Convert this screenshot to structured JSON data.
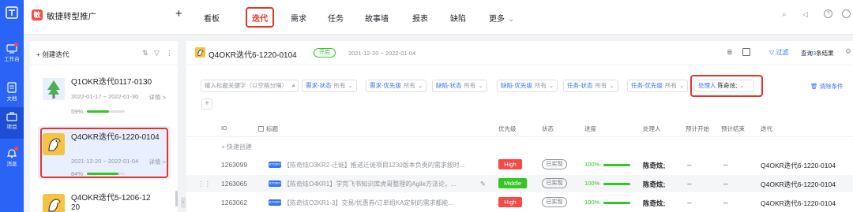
{
  "rail": {
    "items": [
      {
        "label": "工作台",
        "icon": "workbench-icon"
      },
      {
        "label": "文档",
        "icon": "document-icon"
      },
      {
        "label": "项目",
        "icon": "project-icon"
      },
      {
        "label": "消息",
        "icon": "bell-icon"
      }
    ],
    "active": "项目"
  },
  "topbar": {
    "logo_char": "敏",
    "project_name": "敏捷转型推广",
    "add": "+",
    "tabs": [
      "看板",
      "迭代",
      "需求",
      "任务",
      "故事墙",
      "报表",
      "缺陷",
      "更多"
    ],
    "active_tab": "迭代"
  },
  "sidebar": {
    "create_label": "+ 创建迭代",
    "iterations": [
      {
        "name": "Q1OKR迭代0117-0130",
        "dates": "2022-01-17 ~ 2022-01-30",
        "detail": "详情 >",
        "progress": "59%",
        "progress_value": 59,
        "icon": "tree-avatar-icon"
      },
      {
        "name": "Q4OKR迭代6-1220-0104",
        "dates": "2021-12-20 ~ 2022-01-04",
        "detail": "详情 >",
        "progress": "84%",
        "progress_value": 84,
        "icon": "eagle-avatar-icon"
      },
      {
        "name": "Q4OKR迭代5-1206-12",
        "name2": "20",
        "icon": "eagle-avatar-icon"
      }
    ]
  },
  "main": {
    "title": "Q4OKR迭代6-1220-0104",
    "status": "开启",
    "dates": "2021-12-20 ~ 2022-01-04",
    "filter_link": "过滤",
    "result_prefix": "查询",
    "result_count": "3",
    "result_suffix": "条结果",
    "search_placeholder": "输入标题关键字（以空格分隔）",
    "clear_filters": "清除条件",
    "filters": [
      {
        "key": "需求-状态",
        "value": "所有"
      },
      {
        "key": "需求-优先级",
        "value": "所有"
      },
      {
        "key": "缺陷-状态",
        "value": "所有"
      },
      {
        "key": "缺陷-优先级",
        "value": "所有"
      },
      {
        "key": "任务-状态",
        "value": "所有"
      },
      {
        "key": "任务-优先级",
        "value": "所有"
      },
      {
        "key": "处理人",
        "value": "陈奇炫;"
      }
    ],
    "columns": [
      "ID",
      "标题",
      "优先级",
      "状态",
      "进度",
      "处理人",
      "预计开始",
      "预计结束",
      "迭代"
    ],
    "quick_create": "+ 快速创建",
    "rows": [
      {
        "id": "1263099",
        "type": "STORY",
        "title": "【陈奇炫O3KR2-迁徙】推进迁徙项目1230版本负责的需求按时...",
        "priority": "High",
        "priority_color": "#f54a45",
        "status": "已实现",
        "progress": "100%",
        "assignee": "陈奇炫;",
        "start": "--",
        "end": "--",
        "iteration": "Q4OKR迭代6-1220-0104"
      },
      {
        "id": "1263065",
        "type": "STORY",
        "title": "【陈奇炫O4KR1】学完飞书知识库虎哥整理的Agile方法论，...",
        "priority": "Middle",
        "priority_color": "#34c724",
        "status": "已实现",
        "progress": "100%",
        "assignee": "陈奇炫;",
        "start": "--",
        "end": "--",
        "iteration": "Q4OKR迭代6-1220-0104"
      },
      {
        "id": "1263062",
        "type": "STORY",
        "title": "【陈奇炫O2KR1-3】交易/优惠券/订单组KA定制的需求都能...",
        "priority": "High",
        "priority_color": "#f54a45",
        "status": "已实现",
        "progress": "100%",
        "assignee": "陈奇炫;",
        "start": "--",
        "end": "--",
        "iteration": "Q4OKR迭代6-1220-0104"
      }
    ]
  },
  "colors": {
    "accent": "#2a64f6",
    "highlight": "#e5352b",
    "success": "#34c724",
    "danger": "#f54a45"
  }
}
